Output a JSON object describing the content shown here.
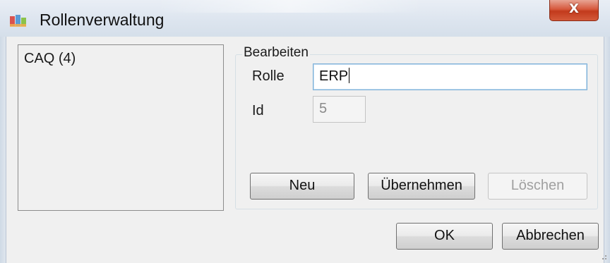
{
  "window": {
    "title": "Rollenverwaltung",
    "close_label": "X",
    "app_icon": "app-icon"
  },
  "roles_list": {
    "items": [
      {
        "label": "CAQ (4)"
      }
    ]
  },
  "edit_group": {
    "legend": "Bearbeiten",
    "rolle_label": "Rolle",
    "rolle_value": "ERP",
    "id_label": "Id",
    "id_value": "5",
    "buttons": {
      "new": "Neu",
      "apply": "Übernehmen",
      "delete": "Löschen"
    }
  },
  "dialog_buttons": {
    "ok": "OK",
    "cancel": "Abbrechen"
  },
  "colors": {
    "close_button": "#c9452a",
    "client_background": "#f0f0f0",
    "focus_border": "#7cb0d8",
    "disabled_text": "#a0a0a0"
  }
}
